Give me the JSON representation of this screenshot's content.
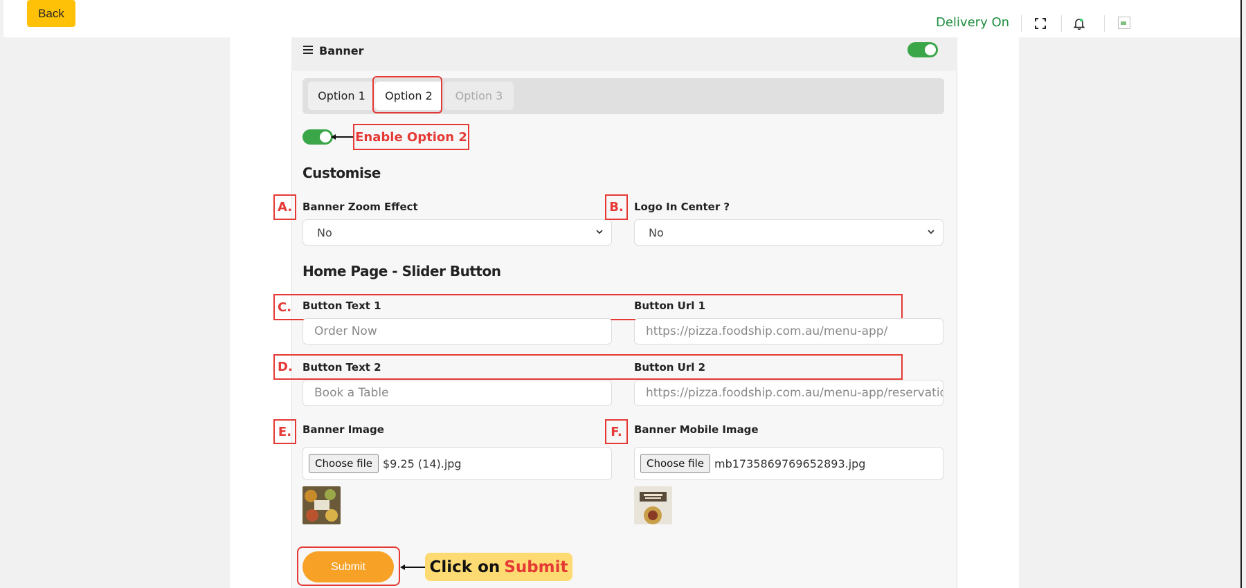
{
  "topbar": {
    "back_label": "Back",
    "delivery_status": "Delivery On",
    "fullscreen_icon": "fullscreen-icon",
    "bell_icon": "bell-icon"
  },
  "card": {
    "title": "Banner",
    "tabs": [
      "Option 1",
      "Option 2",
      "Option 3"
    ]
  },
  "annotations": {
    "enable_option": "Enable Option 2",
    "a": "A.",
    "b": "B.",
    "c": "C.",
    "d": "D.",
    "e": "E.",
    "f": "F.",
    "click_on": "Click on",
    "submit_word": "Submit"
  },
  "customise": {
    "title": "Customise",
    "zoom_label": "Banner Zoom Effect",
    "zoom_value": "No",
    "logo_label": "Logo In Center ?",
    "logo_value": "No"
  },
  "slider": {
    "title": "Home Page - Slider Button",
    "btn_text1_label": "Button Text 1",
    "btn_text1_value": "Order Now",
    "btn_url1_label": "Button Url 1",
    "btn_url1_value": "https://pizza.foodship.com.au/menu-app/",
    "btn_text2_label": "Button Text 2",
    "btn_text2_value": "Book a Table",
    "btn_url2_label": "Button Url 2",
    "btn_url2_value": "https://pizza.foodship.com.au/menu-app/reservation"
  },
  "images": {
    "banner_label": "Banner Image",
    "banner_choose": "Choose file",
    "banner_file": "$9.25 (14).jpg",
    "mobile_label": "Banner Mobile Image",
    "mobile_choose": "Choose file",
    "mobile_file": "mb1735869769652893.jpg"
  },
  "submit_label": "Submit",
  "colors": {
    "accent_yellow": "#ffc107",
    "toggle_green": "#3aa648",
    "annotation_red": "#e53935",
    "submit_orange": "#f7a226",
    "delivery_green": "#1e8e3e"
  }
}
